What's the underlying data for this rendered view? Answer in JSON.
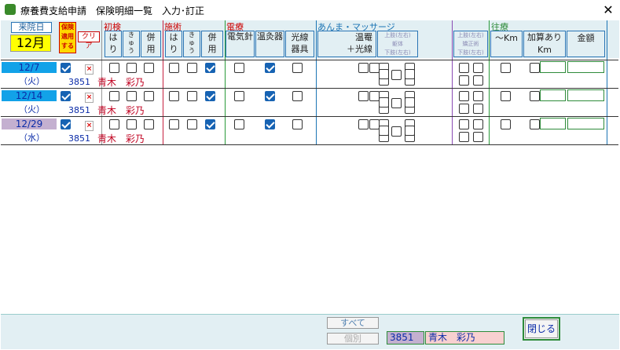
{
  "window": {
    "title": "療養費支給申請　保険明細一覧　入力･訂正",
    "close": "✕"
  },
  "header": {
    "visit_day_label": "来院日",
    "month": "12月",
    "insurance_btn": "保険\n適用\nする",
    "clear_btn": "クリア",
    "groups": {
      "initial": "初検",
      "treatment": "施術",
      "electro": "電療",
      "massage": "あんま・マッサージ",
      "travel": "往療"
    },
    "initial_cols": [
      "は\nり",
      "き\nゅ\nう",
      "併\n用"
    ],
    "treatment_cols": [
      "は\nり",
      "き\nゅ\nう",
      "併\n用"
    ],
    "electro_cols": [
      "電気針",
      "温灸器",
      "光線\n器具"
    ],
    "massage_cols": {
      "warm": "温罨\n＋光線",
      "upper": "上肢(左右)",
      "body": "躯体",
      "lower": "下肢(左右)",
      "upper2": "上肢(左右)",
      "corr": "矯正術",
      "lower2": "下肢(左右)"
    },
    "travel_cols": {
      "km": "～Km",
      "extra": "加算あり\nKm",
      "amount": "金額"
    }
  },
  "rows": [
    {
      "date": "12/7",
      "dow": "（火）",
      "pid": "3851",
      "name": "青木　彩乃",
      "date_bg": "#12a2e8",
      "ins": true,
      "t_combo": true,
      "e_warm": true
    },
    {
      "date": "12/14",
      "dow": "（火）",
      "pid": "3851",
      "name": "青木　彩乃",
      "date_bg": "#12a2e8",
      "ins": true,
      "t_combo": true,
      "e_warm": true
    },
    {
      "date": "12/29",
      "dow": "（水）",
      "pid": "3851",
      "name": "青木　彩乃",
      "date_bg": "#c4b0d0",
      "ins": true,
      "t_combo": true,
      "e_warm": true
    }
  ],
  "footer": {
    "all_btn": "すべて",
    "single_btn": "個別",
    "pid": "3851",
    "pname": "青木　彩乃",
    "close_btn": "閉じる"
  }
}
